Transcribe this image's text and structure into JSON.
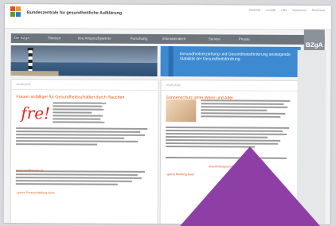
{
  "header": {
    "title": "Bundeszentrale für gesundheitliche Aufklärung",
    "metanav": [
      "Startseite",
      "Kontakt",
      "Hilfe",
      "Impressum",
      "RSS-Feed"
    ]
  },
  "nav": {
    "items": [
      "Die BZgA",
      "Themen",
      "Ihre Ansprechpartner",
      "Forschung",
      "Infomaterialien",
      "Service",
      "Presse"
    ],
    "brand": "BZgA"
  },
  "hero": {
    "panel_text": "Gesundheitserziehung und Gesundheitsförderung ansteigende Stabilität der Gesundheitsfördrung"
  },
  "news_left": {
    "date": "06.08.2010",
    "headline": "Frauen anfälliger für Gesundheitsschäden durch Rauchen",
    "body_lead": "Zum Weltrauchertag am 31. Mai 2010 Frauen anfälliger für Gesundheitsschäden durch Rauchen",
    "link_text": "www.rauchfrei-info.de",
    "more": "› ganze Pressemitteilung lesen",
    "image_text": "rauchfrei!"
  },
  "news_right": {
    "date": "25.05.2010",
    "headline": "Sonnenschutz ohne Wenn und Aber",
    "link_text": "www.kindergesundheit-info.de",
    "more": "› ganze Meldung lesen"
  },
  "colors": {
    "accent": "#e05a18",
    "nav_bg": "#6d747b",
    "panel": "#3d8ad0",
    "overlay": "#8e3fa6"
  }
}
